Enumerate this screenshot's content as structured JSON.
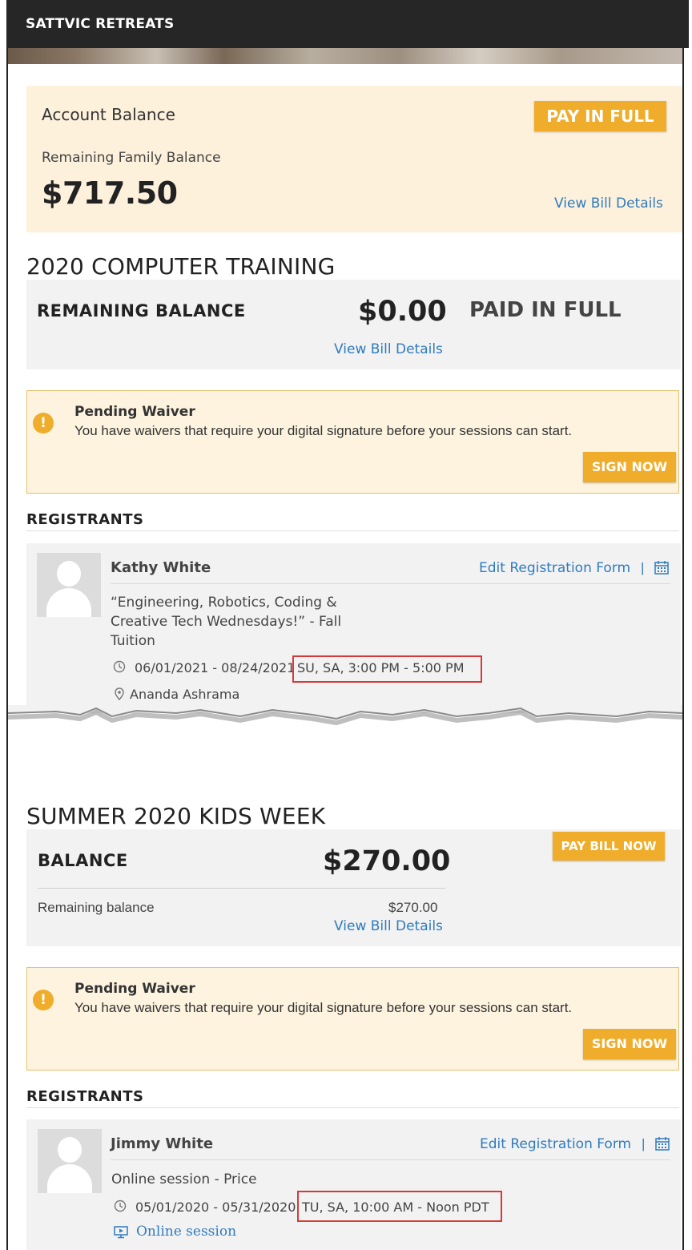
{
  "app": {
    "title": "SATTVIC RETREATS"
  },
  "account": {
    "title": "Account Balance",
    "subtitle": "Remaining Family Balance",
    "amount": "$717.50",
    "pay_button": "PAY IN FULL",
    "view_bill": "View Bill Details"
  },
  "section1": {
    "title": "2020 COMPUTER TRAINING",
    "balance_label": "REMAINING BALANCE",
    "balance_amount": "$0.00",
    "status": "PAID IN FULL",
    "view_bill": "View Bill Details",
    "waiver": {
      "title": "Pending Waiver",
      "text": "You have waivers that require your digital signature before your sessions can start.",
      "button": "SIGN NOW"
    },
    "registrants_label": "REGISTRANTS",
    "registrant": {
      "name": "Kathy White",
      "edit_link": "Edit Registration Form",
      "separator": "|",
      "program_line1": "“Engineering, Robotics, Coding &",
      "program_line2": "Creative Tech Wednesdays!” - Fall",
      "program_line3": "Tuition",
      "dates": "06/01/2021 - 08/24/2021",
      "schedule": "SU, SA, 3:00 PM - 5:00 PM",
      "location": "Ananda Ashrama"
    }
  },
  "section2": {
    "title": "SUMMER 2020 KIDS WEEK",
    "balance_label": "BALANCE",
    "balance_amount": "$270.00",
    "pay_button": "PAY BILL NOW",
    "remaining_label": "Remaining balance",
    "remaining_amount": "$270.00",
    "view_bill": "View Bill Details",
    "waiver": {
      "title": "Pending Waiver",
      "text": "You have waivers that require your digital signature before your sessions can start.",
      "button": "SIGN NOW"
    },
    "registrants_label": "REGISTRANTS",
    "registrant": {
      "name": "Jimmy White",
      "edit_link": "Edit Registration Form",
      "separator": "|",
      "program": "Online session - Price",
      "dates": "05/01/2020 - 05/31/2020",
      "schedule": "TU, SA, 10:00 AM - Noon PDT",
      "online_link": "Online session"
    }
  },
  "colors": {
    "topbar": "#262626",
    "accent_yellow": "#f0ad2c",
    "link_blue": "#2f7bbf",
    "highlight_red": "#d43a3a",
    "card_cream": "#fdf1dc",
    "card_gray": "#f2f2f2"
  },
  "icons": {
    "warning": "exclamation-circle-icon",
    "calendar": "calendar-icon",
    "clock": "clock-icon",
    "location": "map-pin-icon",
    "online": "monitor-icon"
  }
}
